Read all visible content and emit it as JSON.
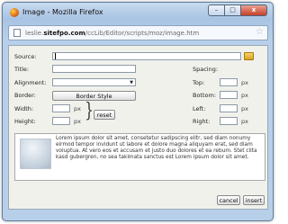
{
  "window": {
    "title": "Image - Mozilla Firefox",
    "minimize": "–",
    "maximize": "□",
    "close": "x"
  },
  "urlbar": {
    "prefix": "leslie.",
    "domain": "sitefpo.com",
    "path": "/ccLib/Editor/scripts/moz/image.htm",
    "star": "☆"
  },
  "form": {
    "source_label": "Source:",
    "source_value": "",
    "title_label": "Title:",
    "title_value": "",
    "alignment_label": "Alignment:",
    "alignment_value": "",
    "border_label": "Border:",
    "border_style_button": "Border Style",
    "width_label": "Width:",
    "width_value": "",
    "height_label": "Height:",
    "height_value": "",
    "px": "px",
    "reset_button": "reset",
    "spacing_label": "Spacing:",
    "top_label": "Top:",
    "top_value": "",
    "bottom_label": "Bottom:",
    "bottom_value": "",
    "left_label": "Left:",
    "left_value": "",
    "right_label": "Right:",
    "right_value": ""
  },
  "preview": {
    "text": "Lorem ipsum dolor sit amet, consetetur sadipscing elitr, sed diam nonumy eirmod tempor invidunt ut labore et dolore magna aliquyam erat, sed diam voluptua. At vero eos et accusam et justo duo dolores et ea rebum. Stet clita kasd gubergren, no sea takimata sanctus est Lorem ipsum dolor sit amet."
  },
  "footer": {
    "cancel": "cancel",
    "insert": "insert"
  }
}
